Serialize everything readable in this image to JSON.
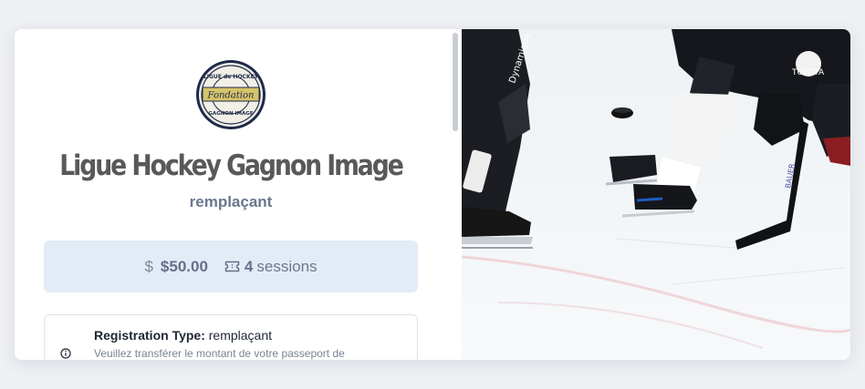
{
  "league": {
    "name": "Ligue Hockey Gagnon Image",
    "subtitle": "remplaçant",
    "logo": {
      "top_text": "LIGUE de HOCKEY",
      "center_text": "Fondation",
      "bottom_text": "GAGNON IMAGE"
    }
  },
  "pricing": {
    "price": "$50.00",
    "sessions_count": "4",
    "sessions_label": "sessions",
    "dollar_icon": "dollar-icon",
    "ticket_icon": "ticket-icon"
  },
  "registration": {
    "type_label": "Registration Type:",
    "type_value": "remplaçant",
    "note": "Veuillez transférer le montant de votre passeport de",
    "info_icon": "info-icon"
  },
  "hero_image": {
    "jersey_text_1": "Dynamique",
    "jersey_text_2": "TOYOTA",
    "stick_text": "BAUER"
  },
  "colors": {
    "page_bg": "#eef0f4",
    "price_box_bg": "#e3ecf6",
    "title_color": "#595959",
    "subtitle_color": "#6b778c"
  }
}
